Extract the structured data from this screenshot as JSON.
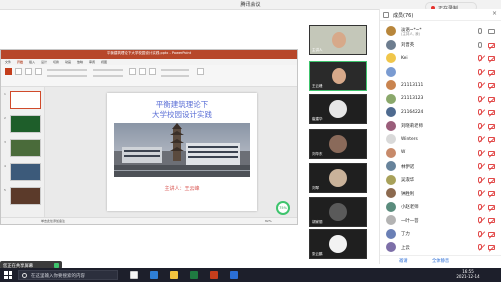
{
  "meeting": {
    "title": "腾讯会议",
    "recording_label": "正在录制",
    "recording_color": "#e5322d"
  },
  "ppt": {
    "window_title": "平衡建筑理论下大学校园设计实践.pptx - PowerPoint",
    "tabs": [
      "文件",
      "开始",
      "插入",
      "设计",
      "切换",
      "动画",
      "放映",
      "审阅",
      "视图"
    ],
    "active_tab_index": 1,
    "slide": {
      "title_line1": "平衡建筑理论下",
      "title_line2": "大学校园设计实践",
      "speaker": "主讲人：王云峰"
    },
    "thumbnail_numbers": [
      "1",
      "2",
      "3",
      "4",
      "5"
    ],
    "status_notes": "单击此处添加备注",
    "status_zoom": "82%",
    "accent_color": "#b7472a"
  },
  "network_badge": "75%",
  "share_bar": {
    "text": "您正在共享屏幕",
    "control_label": "共享中",
    "secondary_text": "点击此处"
  },
  "video_tiles": [
    {
      "name": "主讲人",
      "type": "camera"
    },
    {
      "name": "王云峰",
      "type": "camera"
    },
    {
      "name": "崔建华",
      "type": "avatar"
    },
    {
      "name": "刘华东",
      "type": "avatar"
    },
    {
      "name": "刘琴",
      "type": "avatar"
    },
    {
      "name": "胡家丽",
      "type": "avatar"
    },
    {
      "name": "张云鹏",
      "type": "avatar"
    }
  ],
  "participants": {
    "title": "成员(76)",
    "close_icon": "close-icon",
    "rows": [
      {
        "name": "淡语~*~*",
        "sub": "(主持人, 我)",
        "avatar_color": "#b8863b",
        "mic": "on",
        "cam": "on"
      },
      {
        "name": "刘晋英",
        "sub": "",
        "avatar_color": "#6d7d8f",
        "mic": "on",
        "cam": "off"
      },
      {
        "name": "Kei",
        "sub": "",
        "avatar_color": "#f0c64a",
        "mic": "off",
        "cam": "off"
      },
      {
        "name": "",
        "sub": "",
        "avatar_color": "#7a9bd1",
        "mic": "off",
        "cam": "off"
      },
      {
        "name": "21113111",
        "sub": "",
        "avatar_color": "#c9844f",
        "mic": "off",
        "cam": "off"
      },
      {
        "name": "21113123",
        "sub": "",
        "avatar_color": "#8aa86b",
        "mic": "off",
        "cam": "off"
      },
      {
        "name": "21164224",
        "sub": "",
        "avatar_color": "#4e6a8f",
        "mic": "off",
        "cam": "off"
      },
      {
        "name": "刘晓莉老师",
        "sub": "",
        "avatar_color": "#9a5d7a",
        "mic": "off",
        "cam": "off"
      },
      {
        "name": "Winters",
        "sub": "",
        "avatar_color": "#d9d9d9",
        "mic": "off",
        "cam": "off"
      },
      {
        "name": "W",
        "sub": "",
        "avatar_color": "#c78a6a",
        "mic": "off",
        "cam": "off"
      },
      {
        "name": "林伊诺",
        "sub": "",
        "avatar_color": "#67839b",
        "mic": "off",
        "cam": "off"
      },
      {
        "name": "吴淑华",
        "sub": "",
        "avatar_color": "#a8a15a",
        "mic": "off",
        "cam": "off"
      },
      {
        "name": "钟胜利",
        "sub": "",
        "avatar_color": "#8c6a4f",
        "mic": "off",
        "cam": "off"
      },
      {
        "name": "小赵老师",
        "sub": "",
        "avatar_color": "#5a8c7d",
        "mic": "off",
        "cam": "off"
      },
      {
        "name": "一叶一菩",
        "sub": "",
        "avatar_color": "#b3b3b3",
        "mic": "off",
        "cam": "off"
      },
      {
        "name": "丁力",
        "sub": "",
        "avatar_color": "#6a7fb5",
        "mic": "off",
        "cam": "off"
      },
      {
        "name": "上云",
        "sub": "",
        "avatar_color": "#7d6fa8",
        "mic": "off",
        "cam": "off"
      }
    ],
    "footer_invite": "邀请",
    "footer_manage": "全体静音"
  },
  "taskbar": {
    "search_placeholder": "在这里输入你要搜索的内容",
    "time": "16:55",
    "date": "2021-12-14"
  }
}
